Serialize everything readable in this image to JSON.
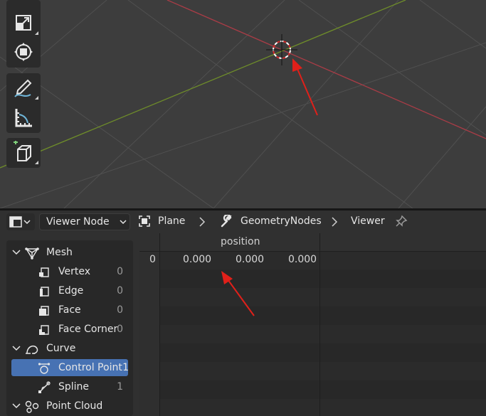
{
  "viewport": {
    "tools": [
      {
        "icon": "scale-icon"
      },
      {
        "icon": "transform-icon"
      },
      {
        "icon": "annotate-icon"
      },
      {
        "icon": "measure-icon"
      },
      {
        "icon": "add-cube-icon"
      }
    ],
    "colors": {
      "background": "#3d3d3d",
      "x_axis": "#a83c46",
      "y_axis": "#6e8c2a",
      "grid": "#505050"
    }
  },
  "header": {
    "editor_type_icon": "spreadsheet-icon",
    "dropdown_value": "Viewer Node",
    "breadcrumbs": [
      {
        "icon": "object-icon",
        "label": "Plane"
      },
      {
        "icon": "wrench-icon",
        "label": "GeometryNodes"
      },
      {
        "icon": "",
        "label": "Viewer"
      }
    ],
    "pin_icon": "pin-icon"
  },
  "tree": [
    {
      "label": "Mesh",
      "icon": "mesh-icon",
      "expanded": true,
      "level": 0
    },
    {
      "label": "Vertex",
      "icon": "vertex-icon",
      "count": "0",
      "level": 1
    },
    {
      "label": "Edge",
      "icon": "edge-icon",
      "count": "0",
      "level": 1
    },
    {
      "label": "Face",
      "icon": "face-icon",
      "count": "0",
      "level": 1
    },
    {
      "label": "Face Corner",
      "icon": "face-corner-icon",
      "count": "0",
      "level": 1
    },
    {
      "label": "Curve",
      "icon": "curve-icon",
      "expanded": true,
      "level": 0
    },
    {
      "label": "Control Point",
      "icon": "control-point-icon",
      "count": "1",
      "level": 1,
      "selected": true
    },
    {
      "label": "Spline",
      "icon": "spline-icon",
      "count": "1",
      "level": 1
    },
    {
      "label": "Point Cloud",
      "icon": "point-cloud-icon",
      "expanded": true,
      "level": 0
    }
  ],
  "spreadsheet": {
    "column_header": "position",
    "rows": [
      {
        "index": "0",
        "values": [
          "0.000",
          "0.000",
          "0.000"
        ]
      }
    ]
  },
  "annotations": {
    "arrow_color": "#e0201a"
  }
}
